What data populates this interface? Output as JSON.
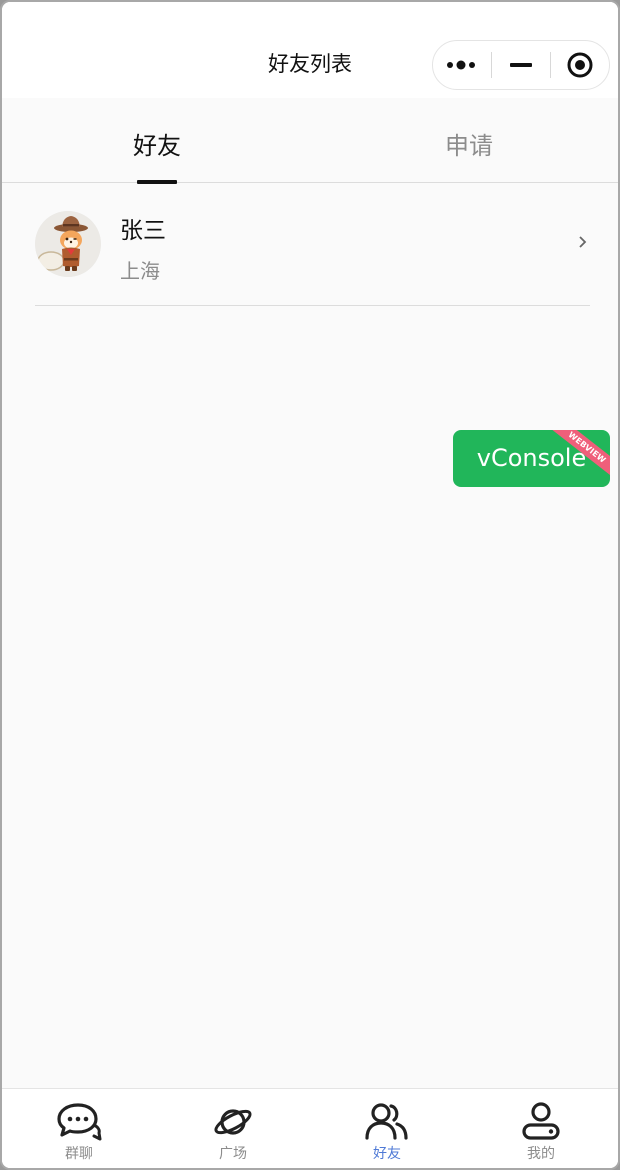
{
  "navbar": {
    "title": "好友列表"
  },
  "tabs": [
    {
      "label": "好友",
      "active": true
    },
    {
      "label": "申请",
      "active": false
    }
  ],
  "friends": [
    {
      "name": "张三",
      "location": "上海"
    }
  ],
  "vconsole": {
    "label": "vConsole",
    "ribbon": "WEBVIEW"
  },
  "tabbar": {
    "items": [
      {
        "label": "群聊",
        "icon": "chat-bubbles-icon"
      },
      {
        "label": "广场",
        "icon": "planet-icon"
      },
      {
        "label": "好友",
        "icon": "friends-icon",
        "active": true
      },
      {
        "label": "我的",
        "icon": "profile-icon"
      }
    ]
  },
  "colors": {
    "accent": "#4f7ad6",
    "vconsole_green": "#21b65a",
    "ribbon_pink": "#ef5f7a"
  }
}
